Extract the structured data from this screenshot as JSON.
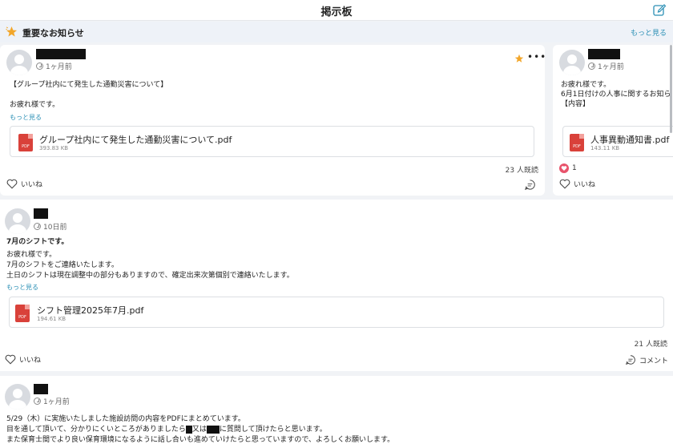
{
  "header": {
    "title": "掲示板"
  },
  "important": {
    "label": "重要なお知らせ",
    "more": "もっと見る"
  },
  "pinned": [
    {
      "time": "1ヶ月前",
      "lines": [
        "【グループ社内にて発生した通勤災害について】",
        "お疲れ様です。"
      ],
      "more": "もっと見る",
      "file": {
        "name": "グループ社内にて発生した通勤災害について.pdf",
        "size": "393.83 KB",
        "icon": "PDF"
      },
      "reads": "23 人既読",
      "like": "いいね"
    },
    {
      "time": "1ヶ月前",
      "lines": [
        "お疲れ様です。",
        "6月1日付けの人事に関するお知ら",
        "【内容】"
      ],
      "file": {
        "name": "人事異動通知書.pdf",
        "size": "143.11 KB",
        "icon": "PDF"
      },
      "reactions": "1",
      "like": "いいね"
    }
  ],
  "posts": [
    {
      "time": "10日前",
      "title": "7月のシフトです。",
      "lines": [
        "お疲れ様です。",
        "7月のシフトをご連絡いたします。",
        "土日のシフトは現在調整中の部分もありますので、確定出来次第個別で連絡いたします。"
      ],
      "more": "もっと見る",
      "file": {
        "name": "シフト管理2025年7月.pdf",
        "size": "194.61 KB",
        "icon": "PDF"
      },
      "reads": "21 人既読",
      "like": "いいね",
      "comment": "コメント"
    },
    {
      "time": "1ヶ月前",
      "line1": "5/29（木）に実施いたしました施設訪問の内容をPDFにまとめています。",
      "line2_a": "目を通して頂いて、分かりにくいところがありましたら",
      "line2_b": "又は",
      "line2_c": "に質問して頂けたらと思います。",
      "line3": "また保育士間でより良い保育環境になるように話し合いも進めていけたらと思っていますので、よろしくお願いします。"
    }
  ]
}
